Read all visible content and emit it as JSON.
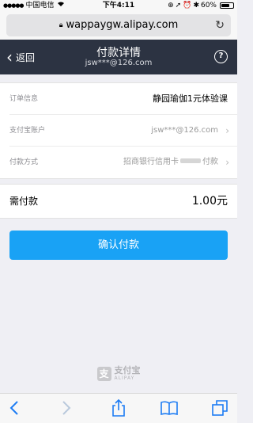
{
  "status_bar": {
    "carrier": "中国电信",
    "time": "下午4:11",
    "battery": "60%"
  },
  "browser": {
    "url": "wappaygw.alipay.com"
  },
  "nav": {
    "back_label": "返回",
    "title": "付款详情",
    "subtitle": "jsw***@126.com"
  },
  "info_rows": [
    {
      "label": "订单信息",
      "value": "静园瑜伽1元体验课"
    },
    {
      "label": "支付宝账户",
      "value": "jsw***@126.com"
    },
    {
      "label": "付款方式",
      "value_prefix": "招商银行信用卡",
      "value_suffix": "付款"
    }
  ],
  "amount": {
    "label": "需付款",
    "value": "1.00元"
  },
  "confirm_button": "确认付款",
  "logo": {
    "cn": "支付宝",
    "en": "ALIPAY"
  },
  "colors": {
    "nav_bg": "#2c3342",
    "button_bg": "#19a2f5",
    "ios_blue": "#1c7cf4"
  }
}
